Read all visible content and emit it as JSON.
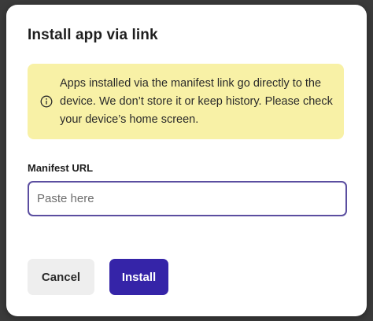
{
  "dialog": {
    "title": "Install app via link",
    "notice": {
      "icon": "info-icon",
      "text": "Apps installed via the manifest link go directly to the device. We don’t store it or keep history. Please check your device’s home screen."
    },
    "manifest_field": {
      "label": "Manifest URL",
      "value": "",
      "placeholder": "Paste here"
    },
    "buttons": {
      "cancel_label": "Cancel",
      "install_label": "Install"
    }
  },
  "colors": {
    "notice_background": "#f8f1a6",
    "input_border": "#5b4ea0",
    "primary_button": "#3524a8",
    "secondary_button": "#eeeeee"
  }
}
